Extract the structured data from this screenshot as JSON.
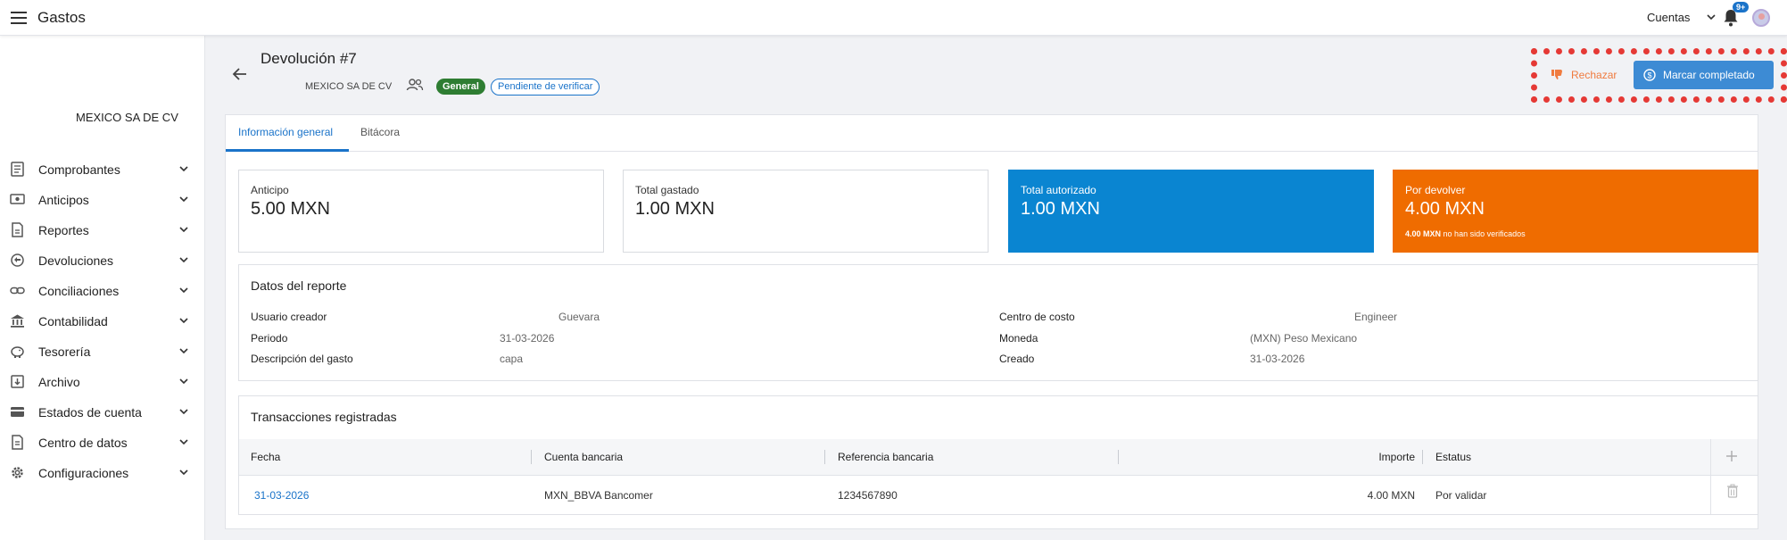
{
  "app": {
    "title": "Gastos"
  },
  "topbar": {
    "accounts_label": "Cuentas",
    "notification_badge": "9+"
  },
  "sidebar": {
    "company": "MEXICO SA DE CV",
    "items": [
      {
        "label": "Comprobantes",
        "icon": "receipt-icon"
      },
      {
        "label": "Anticipos",
        "icon": "money-icon"
      },
      {
        "label": "Reportes",
        "icon": "report-icon"
      },
      {
        "label": "Devoluciones",
        "icon": "refund-icon"
      },
      {
        "label": "Conciliaciones",
        "icon": "link-icon"
      },
      {
        "label": "Contabilidad",
        "icon": "bank-icon"
      },
      {
        "label": "Tesorería",
        "icon": "piggy-bank-icon"
      },
      {
        "label": "Archivo",
        "icon": "archive-icon"
      },
      {
        "label": "Estados de cuenta",
        "icon": "card-icon"
      },
      {
        "label": "Centro de datos",
        "icon": "document-icon"
      },
      {
        "label": "Configuraciones",
        "icon": "gear-icon"
      }
    ]
  },
  "header": {
    "title": "Devolución #7",
    "company": "MEXICO SA DE CV",
    "tag_general": "General",
    "tag_status": "Pendiente de verificar",
    "reject_label": "Rechazar",
    "complete_label": "Marcar completado"
  },
  "tabs": [
    {
      "label": "Información general",
      "active": true
    },
    {
      "label": "Bitácora",
      "active": false
    }
  ],
  "stats": [
    {
      "label": "Anticipo",
      "value": "5.00 MXN",
      "color": "#ffffff"
    },
    {
      "label": "Total gastado",
      "value": "1.00 MXN",
      "color": "#ffffff"
    },
    {
      "label": "Total autorizado",
      "value": "1.00 MXN",
      "color": "#0a85d1"
    },
    {
      "label": "Por devolver",
      "value": "4.00 MXN",
      "color": "#ef6c00",
      "note_amount": "4.00 MXN",
      "note_text": "no han sido verificados"
    }
  ],
  "details": {
    "title": "Datos del reporte",
    "left": [
      {
        "label": "Usuario creador",
        "value": "Guevara"
      },
      {
        "label": "Periodo",
        "value": "31-03-2026"
      },
      {
        "label": "Descripción del gasto",
        "value": "capa"
      }
    ],
    "right": [
      {
        "label": "Centro de costo",
        "value": "Engineer"
      },
      {
        "label": "Moneda",
        "value": "(MXN) Peso Mexicano"
      },
      {
        "label": "Creado",
        "value": "31-03-2026"
      }
    ]
  },
  "transactions": {
    "title": "Transacciones registradas",
    "columns": [
      "Fecha",
      "Cuenta bancaria",
      "Referencia bancaria",
      "Importe",
      "Estatus"
    ],
    "rows": [
      {
        "fecha": "31-03-2026",
        "cuenta": "MXN_BBVA Bancomer",
        "referencia": "1234567890",
        "importe": "4.00 MXN",
        "estatus": "Por validar"
      }
    ]
  },
  "colors": {
    "accent": "#1a73c9",
    "success": "#2e7d32",
    "blue_card": "#0a85d1",
    "orange_card": "#ef6c00",
    "reject": "#f07b3f",
    "highlight": "#e53935"
  }
}
